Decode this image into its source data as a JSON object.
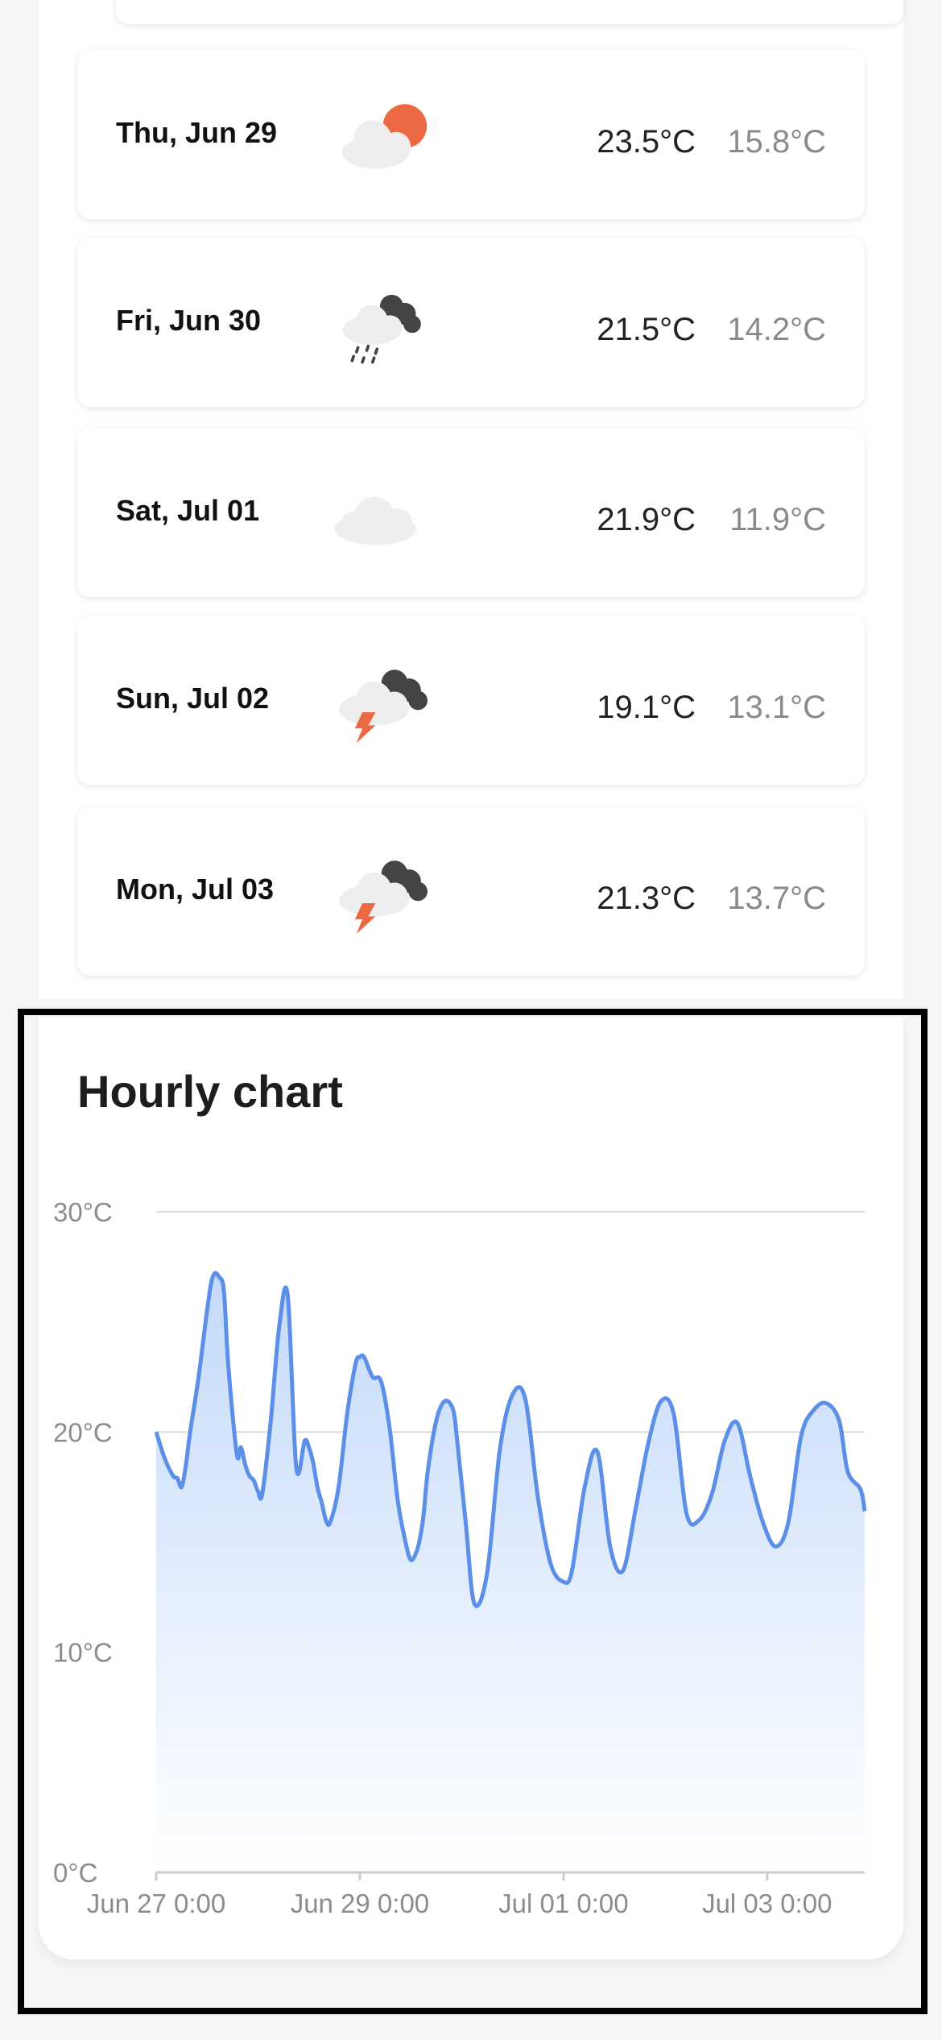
{
  "forecast": {
    "days": [
      {
        "label": "Thu, Jun 29",
        "icon": "partly-cloudy-icon",
        "max": "23.5°C",
        "min": "15.8°C"
      },
      {
        "label": "Fri, Jun 30",
        "icon": "rain-icon",
        "max": "21.5°C",
        "min": "14.2°C"
      },
      {
        "label": "Sat, Jul 01",
        "icon": "cloud-icon",
        "max": "21.9°C",
        "min": "11.9°C"
      },
      {
        "label": "Sun, Jul 02",
        "icon": "thunderstorm-icon",
        "max": "19.1°C",
        "min": "13.1°C"
      },
      {
        "label": "Mon, Jul 03",
        "icon": "thunderstorm-icon",
        "max": "21.3°C",
        "min": "13.7°C"
      }
    ]
  },
  "colors": {
    "accent_line": "#5b8fe8",
    "fill_top": "#c4daf9",
    "sun": "#ec6a43",
    "dark_cloud": "#444444",
    "light_cloud": "#eeeeee"
  },
  "hourly": {
    "title": "Hourly chart"
  },
  "chart_data": {
    "type": "area",
    "title": "Hourly chart",
    "xlabel": "",
    "ylabel": "",
    "ylim": [
      0,
      30
    ],
    "y_ticks": [
      "0°C",
      "10°C",
      "20°C",
      "30°C"
    ],
    "x_tick_labels": [
      "Jun 27 0:00",
      "Jun 29 0:00",
      "Jul 01 0:00",
      "Jul 03 0:00"
    ],
    "x_tick_hours": [
      0,
      48,
      96,
      144
    ],
    "grid": true,
    "series": [
      {
        "x_hours": [
          0,
          2,
          4,
          5,
          6,
          7,
          8,
          10,
          13,
          15,
          16,
          17,
          19,
          20,
          21,
          22,
          23,
          24,
          25,
          27,
          29,
          31,
          33,
          35,
          36,
          37,
          38,
          39,
          40,
          41,
          43,
          45,
          47,
          48,
          49,
          51,
          53,
          55,
          57,
          59,
          60,
          61,
          62,
          63,
          64,
          66,
          68,
          70,
          71,
          73,
          75,
          78,
          81,
          84,
          87,
          90,
          93,
          96,
          98,
          101,
          104,
          107,
          110,
          113,
          116,
          119,
          122,
          125,
          128,
          131,
          134,
          137,
          140,
          143,
          146,
          149,
          152,
          155,
          158,
          161,
          163,
          166,
          167
        ],
        "y": [
          20,
          18.8,
          18,
          17.9,
          17.5,
          18.5,
          20,
          22.5,
          26.8,
          27,
          26.3,
          23,
          19,
          19.3,
          18.5,
          18,
          17.8,
          17.3,
          17.2,
          20.5,
          24.8,
          26.2,
          18.4,
          19.6,
          19.3,
          18.6,
          17.5,
          16.8,
          16,
          15.9,
          17.5,
          20.8,
          23.1,
          23.4,
          23.4,
          22.5,
          22.3,
          20.2,
          16.8,
          14.8,
          14.2,
          14.4,
          15,
          16.2,
          18.2,
          20.5,
          21.4,
          21,
          19.5,
          15.8,
          12.2,
          13.6,
          19.2,
          21.7,
          21.5,
          17,
          14,
          13.2,
          13.7,
          17.5,
          19.1,
          14.8,
          13.7,
          16.5,
          19.5,
          21.4,
          20.8,
          16.3,
          16,
          17.2,
          19.6,
          20.4,
          18,
          15.9,
          14.8,
          15.9,
          19.8,
          21,
          21.3,
          20.5,
          18.2,
          17.4,
          16.4
        ]
      }
    ]
  }
}
